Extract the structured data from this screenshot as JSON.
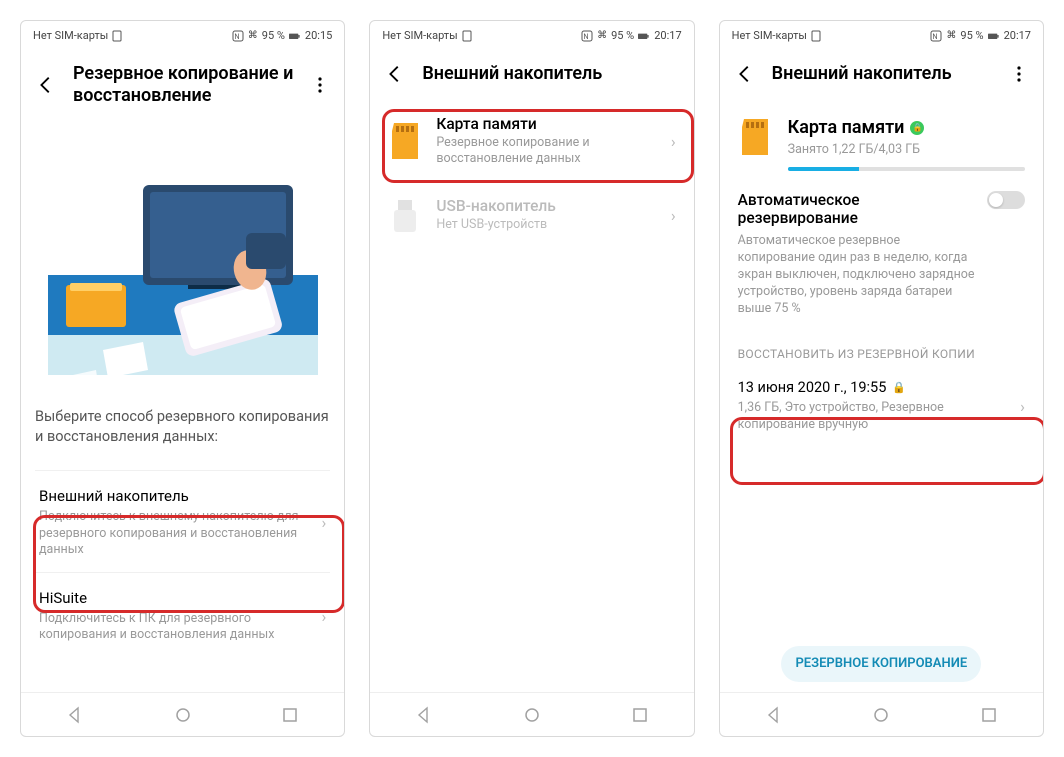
{
  "statusbar": {
    "sim_text": "Нет SIM-карты",
    "battery_pct": "95 %",
    "time1": "20:15",
    "time2": "20:17"
  },
  "screen1": {
    "title": "Резервное копирование и восстановление",
    "prompt": "Выберите способ резервного копирования и восстановления данных:",
    "option_ext_title": "Внешний накопитель",
    "option_ext_sub": "Подключитесь к внешнему накопителю для резервного копирования и восстановления данных",
    "option_hisuite_title": "HiSuite",
    "option_hisuite_sub": "Подключитесь к ПК для резервного копирования и восстановления данных"
  },
  "screen2": {
    "title": "Внешний накопитель",
    "card_title": "Карта памяти",
    "card_sub": "Резервное копирование и восстановление данных",
    "usb_title": "USB-накопитель",
    "usb_sub": "Нет USB-устройств"
  },
  "screen3": {
    "title": "Внешний накопитель",
    "mem_title": "Карта памяти",
    "mem_sub": "Занято 1,22 ГБ/4,03 ГБ",
    "auto_title": "Автоматическое резервирование",
    "auto_sub": "Автоматическое резервное копирование один раз в неделю, когда экран выключен, подключено зарядное устройство, уровень заряда батареи выше 75 %",
    "restore_header": "ВОССТАНОВИТЬ ИЗ РЕЗЕРВНОЙ КОПИИ",
    "backup_date": "13 июня 2020 г., 19:55",
    "backup_sub": "1,36 ГБ, Это устройство, Резервное копирование вручную",
    "cta": "РЕЗЕРВНОЕ КОПИРОВАНИЕ"
  }
}
